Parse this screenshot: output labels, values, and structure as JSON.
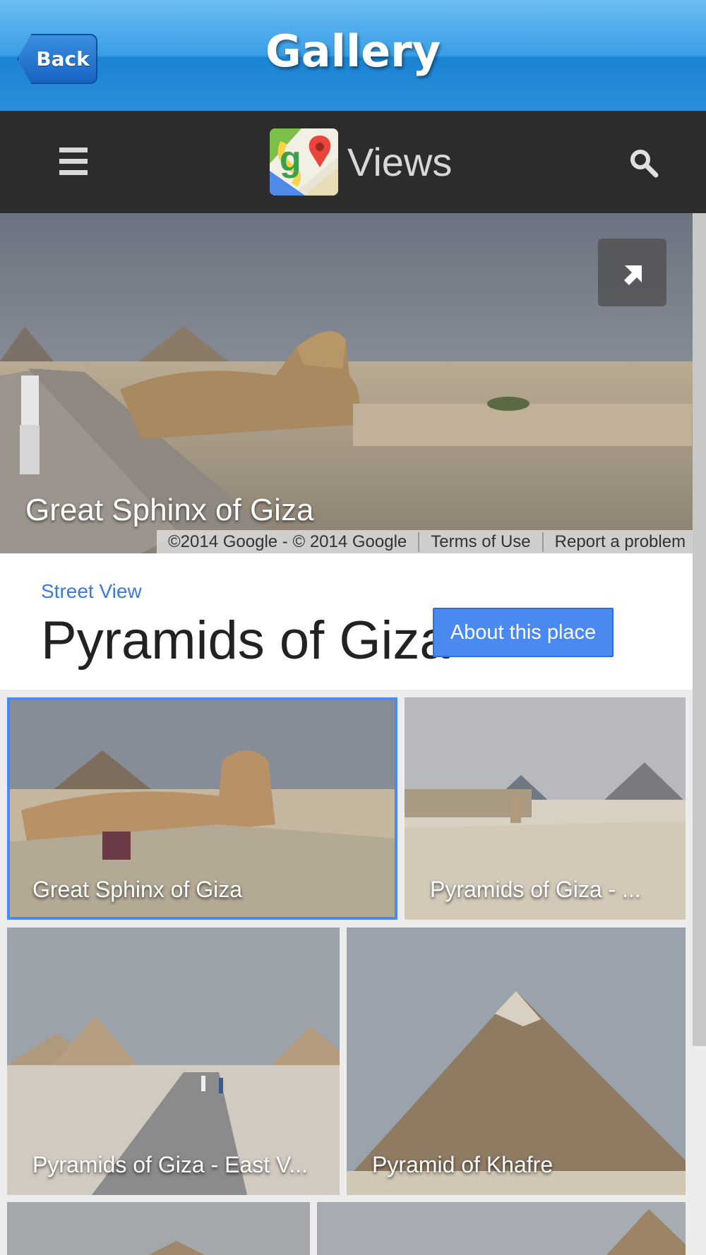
{
  "topbar": {
    "back_label": "Back",
    "title": "Gallery"
  },
  "appbar": {
    "menu_icon": "menu-icon",
    "logo_icon": "google-maps-icon",
    "title": "Views",
    "search_icon": "search-icon"
  },
  "hero": {
    "caption": "Great Sphinx of Giza",
    "copyright": "©2014 Google - © 2014 Google",
    "terms": "Terms of Use",
    "report": "Report a problem",
    "expand_icon": "expand-arrow-icon"
  },
  "place": {
    "subtitle": "Street View",
    "title": "Pyramids of Giza",
    "about_label": "About this place"
  },
  "thumbnails": [
    {
      "caption": "Great Sphinx of Giza",
      "selected": true
    },
    {
      "caption": "Pyramids of Giza - ...",
      "selected": false
    },
    {
      "caption": "Pyramids of Giza - East V...",
      "selected": false
    },
    {
      "caption": "Pyramid of Khafre",
      "selected": false
    }
  ],
  "colors": {
    "accent": "#4a8af0",
    "appbar": "#2c2c2c",
    "topbar": "#2a8fdc"
  }
}
